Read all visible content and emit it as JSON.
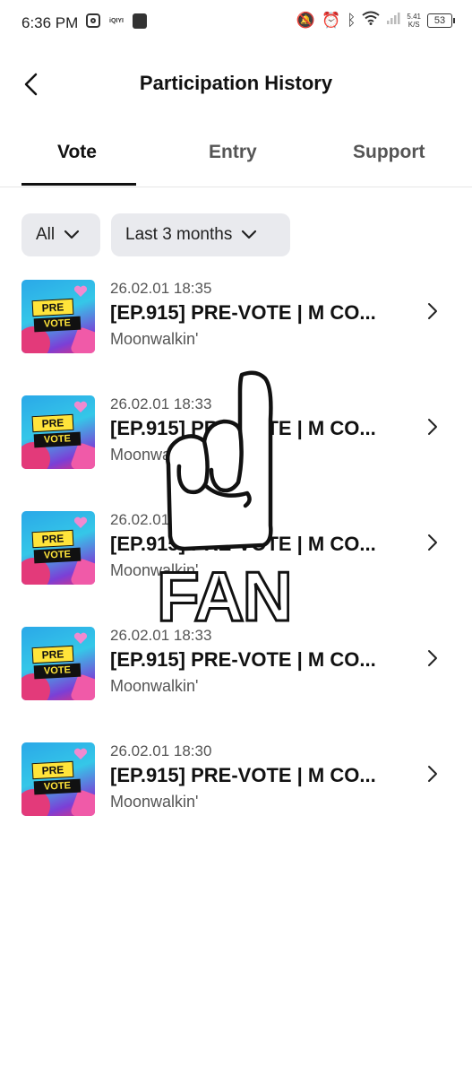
{
  "status_bar": {
    "time": "6:36 PM",
    "app_label": "iQIYI",
    "speed_value": "5.41",
    "speed_unit": "K/S",
    "battery": "53"
  },
  "header": {
    "title": "Participation History"
  },
  "tabs": [
    {
      "label": "Vote",
      "active": true
    },
    {
      "label": "Entry",
      "active": false
    },
    {
      "label": "Support",
      "active": false
    }
  ],
  "filters": {
    "type": "All",
    "range": "Last 3 months"
  },
  "thumbnail": {
    "line1": "PRE",
    "line2": "VOTE"
  },
  "items": [
    {
      "date": "26.02.01 18:35",
      "title": "[EP.915] PRE-VOTE | M CO...",
      "subtitle": "Moonwalkin'"
    },
    {
      "date": "26.02.01 18:33",
      "title": "[EP.915] PRE-VOTE | M CO...",
      "subtitle": "Moonwalkin'"
    },
    {
      "date": "26.02.01 18:33",
      "title": "[EP.915] PRE-VOTE | M CO...",
      "subtitle": "Moonwalkin'"
    },
    {
      "date": "26.02.01 18:33",
      "title": "[EP.915] PRE-VOTE | M CO...",
      "subtitle": "Moonwalkin'"
    },
    {
      "date": "26.02.01 18:30",
      "title": "[EP.915] PRE-VOTE | M CO...",
      "subtitle": "Moonwalkin'"
    }
  ],
  "watermark": {
    "text": "FAN"
  },
  "colors": {
    "accent": "#111111",
    "filter_bg": "#e9eaee",
    "muted_text": "#555555"
  }
}
